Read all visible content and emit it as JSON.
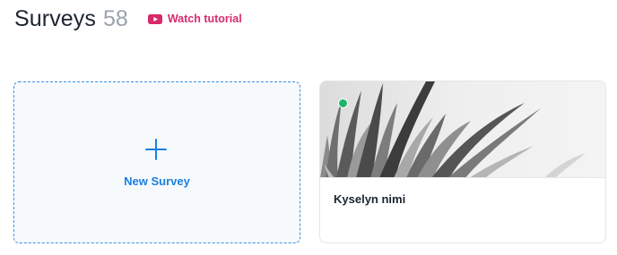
{
  "header": {
    "title": "Surveys",
    "count": "58",
    "tutorial_label": "Watch tutorial",
    "tutorial_icon": "youtube-play-icon"
  },
  "new_survey": {
    "label": "New Survey",
    "icon": "plus-icon"
  },
  "surveys": [
    {
      "name": "Kyselyn nimi",
      "status": "active",
      "status_color": "#1fb46a",
      "image": "grass-leaves-grayscale"
    }
  ],
  "colors": {
    "accent": "#1c7fe0",
    "tutorial": "#d62b6a",
    "title": "#1b2430",
    "count": "#9aa3ad"
  }
}
